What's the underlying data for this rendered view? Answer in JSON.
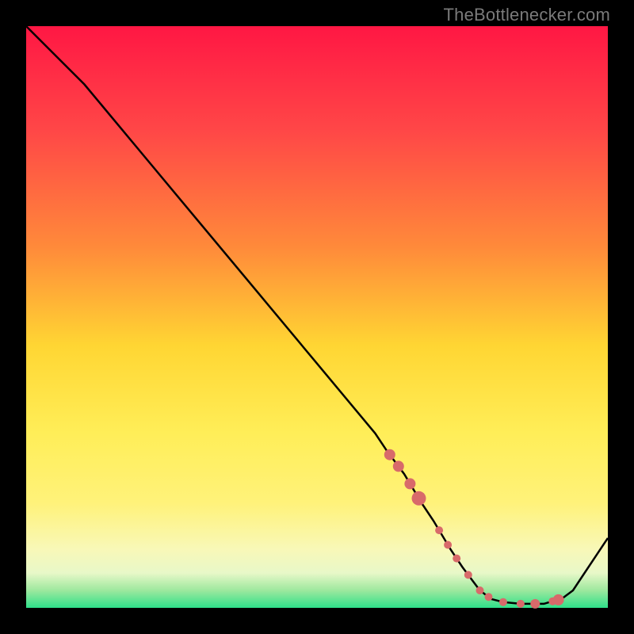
{
  "watermark": "TheBottlenecker.com",
  "colors": {
    "line": "#000000",
    "marker": "#d86a6a"
  },
  "chart_data": {
    "type": "line",
    "title": "",
    "xlabel": "",
    "ylabel": "",
    "xlim": [
      0,
      100
    ],
    "ylim": [
      0,
      100
    ],
    "x": [
      0,
      3,
      6,
      10,
      20,
      30,
      40,
      50,
      60,
      62,
      65,
      68,
      70,
      73,
      75,
      78,
      80,
      82,
      85,
      87,
      89,
      90,
      92,
      94,
      96,
      98,
      100
    ],
    "y": [
      100,
      97,
      94,
      90,
      78,
      66,
      54,
      42,
      30,
      27,
      23,
      18,
      15,
      10,
      7,
      3,
      1.5,
      1,
      0.7,
      0.7,
      0.7,
      1,
      1.5,
      3,
      6,
      9,
      12
    ],
    "markers_x": [
      62.5,
      64,
      66,
      67.5,
      71,
      72.5,
      74,
      76,
      78,
      79.5,
      82,
      85,
      87.5,
      90.5,
      91.5
    ],
    "markers_y": [
      null,
      null,
      null,
      null,
      null,
      null,
      null,
      null,
      null,
      null,
      null,
      null,
      null,
      null,
      null
    ],
    "marker_size_px": [
      7,
      7,
      7,
      9,
      5,
      5,
      5,
      5,
      5,
      5,
      5,
      5,
      6,
      5,
      7
    ]
  }
}
